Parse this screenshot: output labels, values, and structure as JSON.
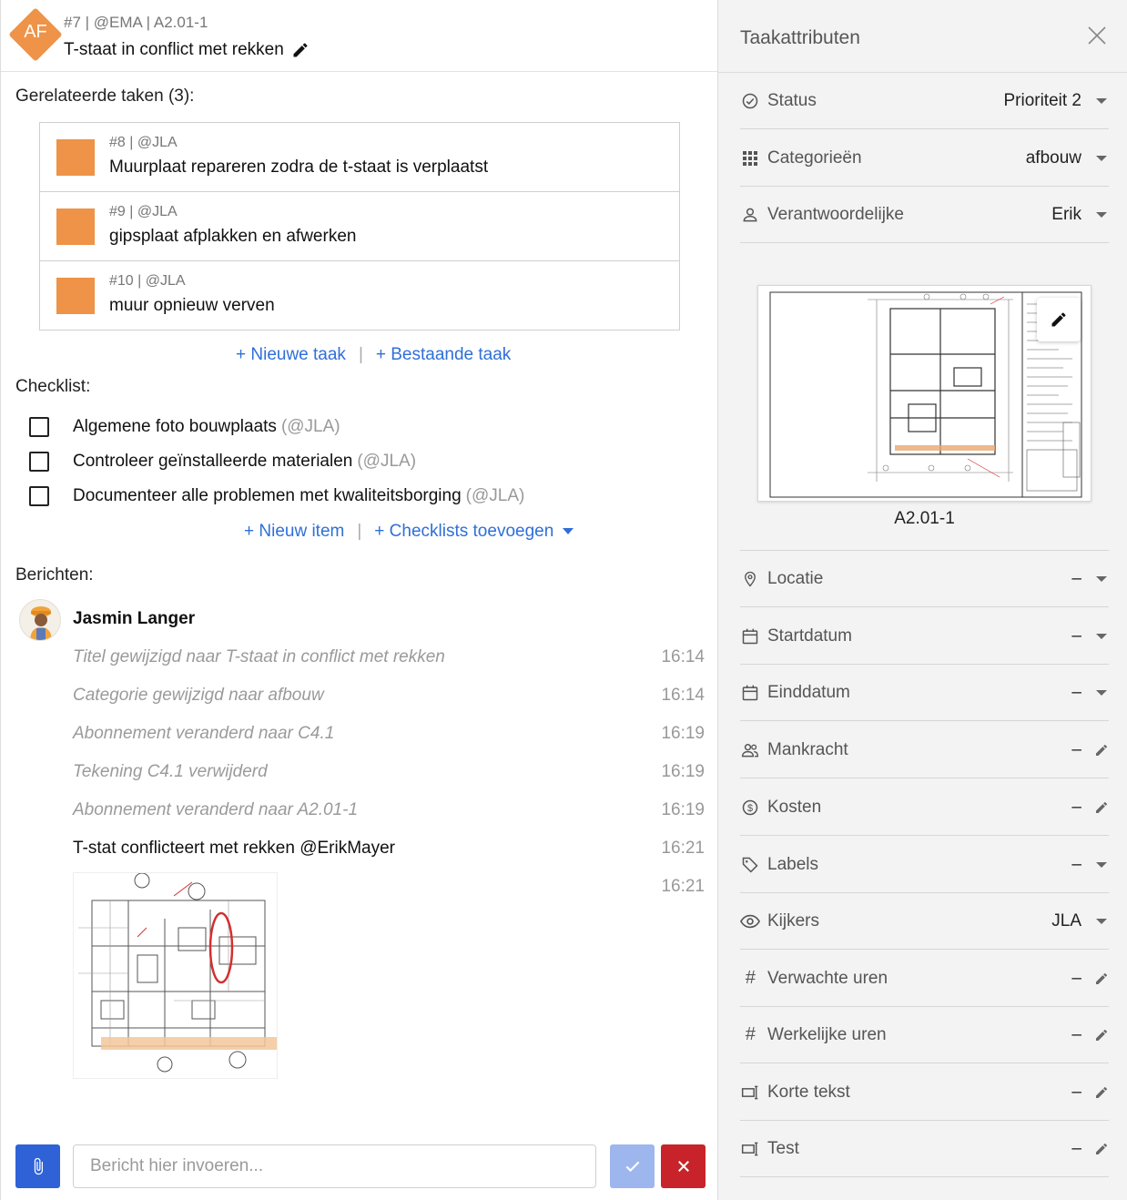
{
  "header": {
    "avatar_initials": "AF",
    "task_meta": "#7 | @EMA | A2.01-1",
    "task_title": "T-staat in conflict met rekken"
  },
  "related": {
    "heading": "Gerelateerde taken (3):",
    "items": [
      {
        "meta": "#8 | @JLA",
        "title": "Muurplaat repareren zodra de t-staat is verplaatst",
        "color": "#ee9347"
      },
      {
        "meta": "#9 | @JLA",
        "title": "gipsplaat afplakken en afwerken",
        "color": "#ee9347"
      },
      {
        "meta": "#10 | @JLA",
        "title": "muur opnieuw verven",
        "color": "#ee9347"
      }
    ],
    "new_task": "+ Nieuwe taak",
    "existing_task": "+ Bestaande taak"
  },
  "checklist": {
    "heading": "Checklist:",
    "items": [
      {
        "text": "Algemene foto bouwplaats",
        "user": "(@JLA)",
        "checked": false
      },
      {
        "text": "Controleer geïnstalleerde materialen",
        "user": "(@JLA)",
        "checked": false
      },
      {
        "text": "Documenteer alle problemen met kwaliteitsborging",
        "user": "(@JLA)",
        "checked": false
      }
    ],
    "new_item": "+ Nieuw item",
    "add_checklists": "+ Checklists toevoegen"
  },
  "messages": {
    "heading": "Berichten:",
    "author": "Jasmin Langer",
    "items": [
      {
        "text": "Titel gewijzigd naar T-staat in conflict met rekken",
        "time": "16:14",
        "system": true
      },
      {
        "text": "Categorie gewijzigd naar afbouw",
        "time": "16:14",
        "system": true
      },
      {
        "text": "Abonnement veranderd naar C4.1",
        "time": "16:19",
        "system": true
      },
      {
        "text": "Tekening C4.1 verwijderd",
        "time": "16:19",
        "system": true
      },
      {
        "text": "Abonnement veranderd naar A2.01-1",
        "time": "16:19",
        "system": true
      },
      {
        "text": "T-stat conflicteert met rekken @ErikMayer",
        "time": "16:21",
        "system": false
      },
      {
        "text": "",
        "time": "16:21",
        "system": false
      }
    ]
  },
  "composer": {
    "placeholder": "Bericht hier invoeren..."
  },
  "attributes": {
    "title": "Taakattributen",
    "top": [
      {
        "label": "Status",
        "value": "Prioriteit 2",
        "icon": "check-circle-icon",
        "action": "dropdown"
      },
      {
        "label": "Categorieën",
        "value": "afbouw",
        "icon": "grid-icon",
        "action": "dropdown"
      },
      {
        "label": "Verantwoordelijke",
        "value": "Erik",
        "icon": "person-icon",
        "action": "dropdown"
      }
    ],
    "drawing_label": "A2.01-1",
    "bottom": [
      {
        "label": "Locatie",
        "value": "–",
        "icon": "location-pin-icon",
        "action": "dropdown"
      },
      {
        "label": "Startdatum",
        "value": "–",
        "icon": "calendar-icon",
        "action": "dropdown"
      },
      {
        "label": "Einddatum",
        "value": "–",
        "icon": "calendar-icon",
        "action": "dropdown"
      },
      {
        "label": "Mankracht",
        "value": "–",
        "icon": "people-icon",
        "action": "edit"
      },
      {
        "label": "Kosten",
        "value": "–",
        "icon": "dollar-circle-icon",
        "action": "edit"
      },
      {
        "label": "Labels",
        "value": "–",
        "icon": "tag-icon",
        "action": "dropdown"
      },
      {
        "label": "Kijkers",
        "value": "JLA",
        "icon": "eye-icon",
        "action": "dropdown"
      },
      {
        "label": "Verwachte uren",
        "value": "–",
        "icon": "hash-icon",
        "action": "edit"
      },
      {
        "label": "Werkelijke uren",
        "value": "–",
        "icon": "hash-icon",
        "action": "edit"
      },
      {
        "label": "Korte tekst",
        "value": "–",
        "icon": "text-field-icon",
        "action": "edit"
      },
      {
        "label": "Test",
        "value": "–",
        "icon": "text-field-icon",
        "action": "edit"
      }
    ]
  },
  "colors": {
    "accent": "#2f6fd8",
    "task_orange": "#ee9347",
    "danger": "#c8232a",
    "attach_blue": "#2f62d6"
  }
}
